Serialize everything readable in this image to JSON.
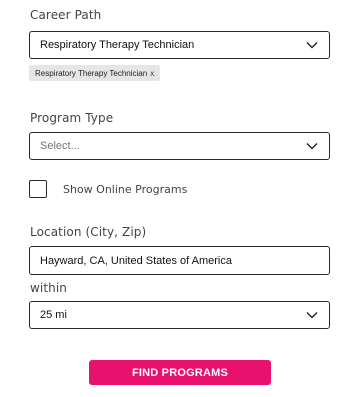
{
  "career_path": {
    "label": "Career Path",
    "selected": "Respiratory Therapy Technician",
    "tag": {
      "text": "Respiratory Therapy Technician",
      "remove": "x"
    }
  },
  "program_type": {
    "label": "Program Type",
    "placeholder": "Select..."
  },
  "online": {
    "label": "Show Online Programs",
    "checked": false
  },
  "location": {
    "label": "Location (City, Zip)",
    "value": "Hayward, CA, United States of America"
  },
  "within": {
    "label": "within",
    "selected": "25 mi"
  },
  "find_button": {
    "label": "FIND PROGRAMS"
  },
  "colors": {
    "accent": "#e8116e",
    "border": "#2a2a2a",
    "tag_bg": "#e6e6e6"
  }
}
